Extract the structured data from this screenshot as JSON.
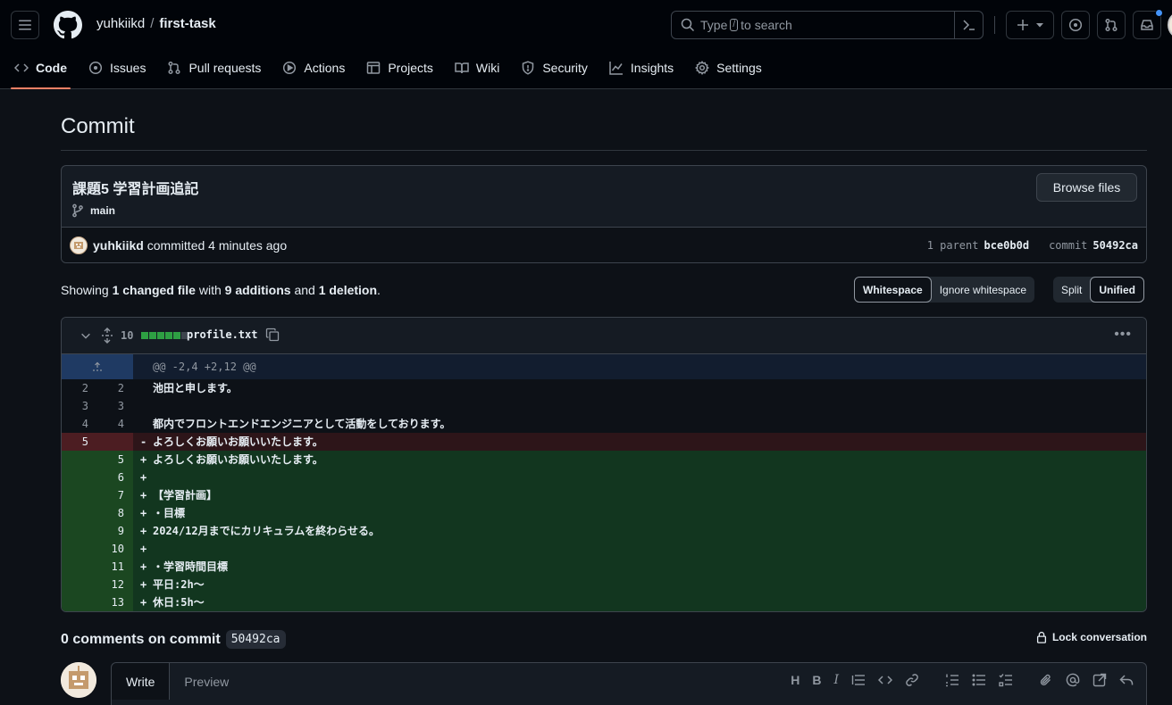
{
  "header": {
    "owner": "yuhkiikd",
    "separator": "/",
    "repo": "first-task",
    "search_prefix": "Type",
    "search_key": "/",
    "search_suffix": "to search",
    "inbox_dot_color": "#4493f8"
  },
  "tabs": [
    {
      "label": "Code",
      "icon": "code-icon"
    },
    {
      "label": "Issues",
      "icon": "issue-icon"
    },
    {
      "label": "Pull requests",
      "icon": "pull-request-icon"
    },
    {
      "label": "Actions",
      "icon": "play-icon"
    },
    {
      "label": "Projects",
      "icon": "table-icon"
    },
    {
      "label": "Wiki",
      "icon": "book-icon"
    },
    {
      "label": "Security",
      "icon": "shield-icon"
    },
    {
      "label": "Insights",
      "icon": "graph-icon"
    },
    {
      "label": "Settings",
      "icon": "gear-icon"
    }
  ],
  "page": {
    "title": "Commit"
  },
  "commit": {
    "message": "課題5 学習計画追記",
    "branch": "main",
    "browse_label": "Browse files",
    "author": "yuhkiikd",
    "action": "committed",
    "time": "4 minutes ago",
    "parent_label": "1 parent",
    "parent_sha": "bce0b0d",
    "commit_label": "commit",
    "commit_sha": "50492ca"
  },
  "summary": {
    "showing": "Showing",
    "files": "1 changed file",
    "with": "with",
    "additions": "9 additions",
    "and": "and",
    "deletions": "1 deletion",
    "period": ".",
    "whitespace": "Whitespace",
    "ignore_whitespace": "Ignore whitespace",
    "split": "Split",
    "unified": "Unified"
  },
  "diff": {
    "changes_count": "10",
    "filename": "profile.txt",
    "hunk_header": "@@ -2,4 +2,12 @@",
    "add_color": "#2ea043",
    "del_color": "#f85149",
    "lines": [
      {
        "type": "ctx",
        "old": "2",
        "new": "2",
        "sign": "",
        "text": "池田と申します。"
      },
      {
        "type": "ctx",
        "old": "3",
        "new": "3",
        "sign": "",
        "text": ""
      },
      {
        "type": "ctx",
        "old": "4",
        "new": "4",
        "sign": "",
        "text": "都内でフロントエンドエンジニアとして活動をしております。"
      },
      {
        "type": "del",
        "old": "5",
        "new": "",
        "sign": "-",
        "text": "よろしくお願いお願いいたします。"
      },
      {
        "type": "add",
        "old": "",
        "new": "5",
        "sign": "+",
        "text": "よろしくお願いお願いいたします。"
      },
      {
        "type": "add",
        "old": "",
        "new": "6",
        "sign": "+",
        "text": ""
      },
      {
        "type": "add",
        "old": "",
        "new": "7",
        "sign": "+",
        "text": "【学習計画】"
      },
      {
        "type": "add",
        "old": "",
        "new": "8",
        "sign": "+",
        "text": "・目標"
      },
      {
        "type": "add",
        "old": "",
        "new": "9",
        "sign": "+",
        "text": "2024/12月までにカリキュラムを終わらせる。"
      },
      {
        "type": "add",
        "old": "",
        "new": "10",
        "sign": "+",
        "text": ""
      },
      {
        "type": "add",
        "old": "",
        "new": "11",
        "sign": "+",
        "text": "・学習時間目標"
      },
      {
        "type": "add",
        "old": "",
        "new": "12",
        "sign": "+",
        "text": "平日:2h〜"
      },
      {
        "type": "add",
        "old": "",
        "new": "13",
        "sign": "+",
        "text": "休日:5h〜"
      }
    ]
  },
  "comments": {
    "title": "0 comments on commit",
    "sha": "50492ca",
    "lock_label": "Lock conversation",
    "write_tab": "Write",
    "preview_tab": "Preview",
    "toolbar": [
      "heading-icon",
      "bold-icon",
      "italic-icon",
      "quote-icon",
      "code-icon",
      "link-icon",
      "ordered-list-icon",
      "unordered-list-icon",
      "task-list-icon",
      "attach-icon",
      "mention-icon",
      "reference-icon",
      "reply-icon"
    ]
  }
}
